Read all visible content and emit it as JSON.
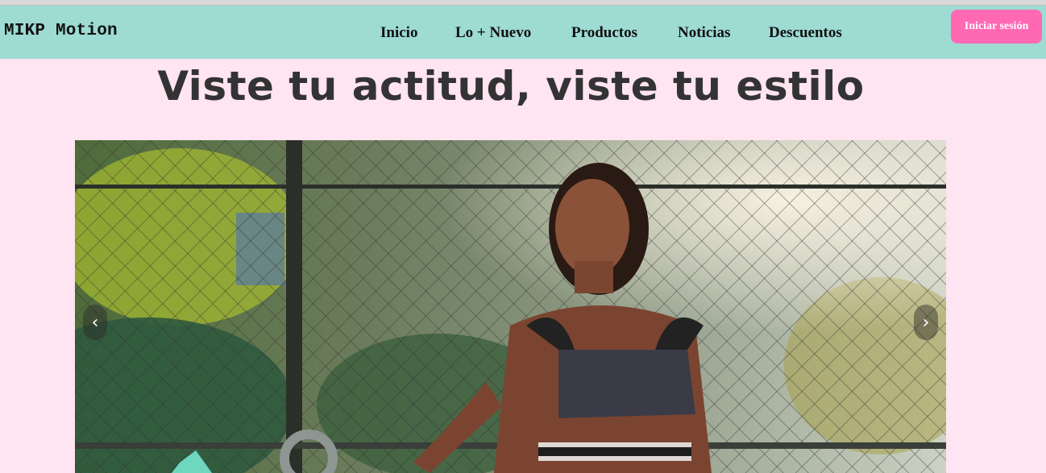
{
  "brand": {
    "name": "MIKP Motion"
  },
  "nav": {
    "items": [
      {
        "label": "Inicio"
      },
      {
        "label": "Lo + Nuevo"
      },
      {
        "label": "Productos"
      },
      {
        "label": "Noticias"
      },
      {
        "label": "Descuentos"
      }
    ]
  },
  "login": {
    "label": "Iniciar sesión"
  },
  "hero": {
    "title": "Viste tu actitud, viste tu estilo"
  },
  "carousel": {
    "prev_icon": "‹",
    "next_icon": "›",
    "image_description_icon": "fitness-photo"
  },
  "colors": {
    "navbar": "#9ddbd3",
    "page_background": "#ffe4f1",
    "login_button": "#ff69b4",
    "title_text": "#333333"
  }
}
